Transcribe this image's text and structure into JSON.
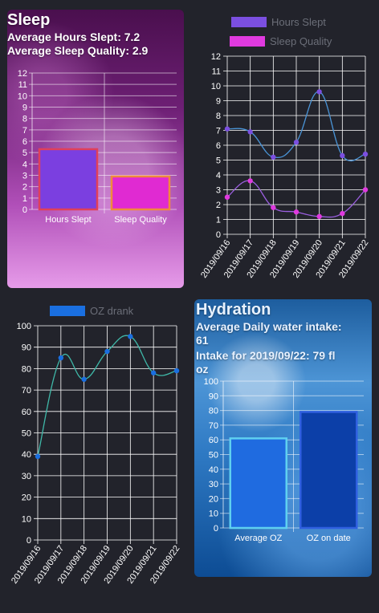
{
  "sleep": {
    "title": "Sleep",
    "avg_hours_text": "Average Hours Slept: 7.2",
    "avg_quality_text": "Average Sleep Quality: 2.9",
    "bar_chart": {
      "type": "bar",
      "categories": [
        "Hours Slept",
        "Sleep Quality"
      ],
      "values": [
        5.3,
        2.9
      ],
      "ylim": [
        0,
        12
      ],
      "colors": [
        "#7b3fe0",
        "#e02ad2"
      ],
      "borders": [
        "#e0405a",
        "#f08a3c"
      ]
    }
  },
  "sleep_trend": {
    "legend": [
      "Hours Slept",
      "Sleep Quality"
    ],
    "colors": [
      "#7b4fe0",
      "#e03adf"
    ],
    "line_colors": [
      "#4a95d8",
      "#9b5fe0"
    ],
    "dates": [
      "2019/09/16",
      "2019/09/17",
      "2019/09/18",
      "2019/09/19",
      "2019/09/20",
      "2019/09/21",
      "2019/09/22"
    ],
    "hours": [
      7.1,
      6.9,
      5.2,
      6.2,
      9.6,
      5.3,
      5.4
    ],
    "quality": [
      2.5,
      3.6,
      1.8,
      1.5,
      1.2,
      1.4,
      3.0
    ],
    "ylim": [
      0,
      12
    ]
  },
  "water_trend": {
    "legend": [
      "OZ drank"
    ],
    "color": "#1a6fe0",
    "line_color": "#3fb8a8",
    "dates": [
      "2019/09/16",
      "2019/09/17",
      "2019/09/18",
      "2019/09/19",
      "2019/09/20",
      "2019/09/21",
      "2019/09/22"
    ],
    "values": [
      39,
      85,
      75,
      88,
      95,
      78,
      79
    ],
    "ylim": [
      0,
      100
    ]
  },
  "hydration": {
    "title": "Hydration",
    "avg_text_line1": "Average Daily water intake:",
    "avg_text_line2": "61",
    "today_text_line1": "Intake for 2019/09/22: 79 fl",
    "today_text_line2": "oz",
    "bar_chart": {
      "type": "bar",
      "categories": [
        "Average OZ",
        "OZ on date"
      ],
      "values": [
        61,
        79
      ],
      "ylim": [
        0,
        100
      ],
      "colors": [
        "#1f6be0",
        "#0c3fa8"
      ],
      "borders": [
        "#5fd0f0",
        "#2f5fe0"
      ]
    }
  },
  "chart_data": [
    {
      "type": "bar",
      "categories": [
        "Hours Slept",
        "Sleep Quality"
      ],
      "values": [
        5.3,
        2.9
      ],
      "ylim": [
        0,
        12
      ]
    },
    {
      "type": "line",
      "x": [
        "2019/09/16",
        "2019/09/17",
        "2019/09/18",
        "2019/09/19",
        "2019/09/20",
        "2019/09/21",
        "2019/09/22"
      ],
      "series": [
        {
          "name": "Hours Slept",
          "values": [
            7.1,
            6.9,
            5.2,
            6.2,
            9.6,
            5.3,
            5.4
          ]
        },
        {
          "name": "Sleep Quality",
          "values": [
            2.5,
            3.6,
            1.8,
            1.5,
            1.2,
            1.4,
            3.0
          ]
        }
      ],
      "ylim": [
        0,
        12
      ]
    },
    {
      "type": "line",
      "x": [
        "2019/09/16",
        "2019/09/17",
        "2019/09/18",
        "2019/09/19",
        "2019/09/20",
        "2019/09/21",
        "2019/09/22"
      ],
      "series": [
        {
          "name": "OZ drank",
          "values": [
            39,
            85,
            75,
            88,
            95,
            78,
            79
          ]
        }
      ],
      "ylim": [
        0,
        100
      ]
    },
    {
      "type": "bar",
      "categories": [
        "Average OZ",
        "OZ on date"
      ],
      "values": [
        61,
        79
      ],
      "ylim": [
        0,
        100
      ]
    }
  ]
}
